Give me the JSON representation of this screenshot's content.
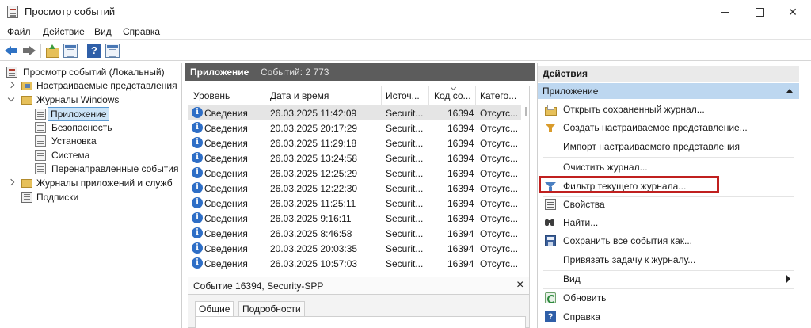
{
  "window": {
    "title": "Просмотр событий"
  },
  "menu": [
    "Файл",
    "Действие",
    "Вид",
    "Справка"
  ],
  "toolbar": {
    "help_glyph": "?"
  },
  "tree": {
    "root": "Просмотр событий (Локальный)",
    "custom_views": "Настраиваемые представления",
    "windows_logs": "Журналы Windows",
    "logs": [
      "Приложение",
      "Безопасность",
      "Установка",
      "Система",
      "Перенаправленные события"
    ],
    "app_logs": "Журналы приложений и служб",
    "subscriptions": "Подписки",
    "selected": "Приложение"
  },
  "center": {
    "title": "Приложение",
    "count": "Событий: 2 773",
    "columns": [
      "Уровень",
      "Дата и время",
      "Источ...",
      "Код со...",
      "Катего..."
    ],
    "rows": [
      {
        "level": "Сведения",
        "datetime": "26.03.2025 11:42:09",
        "source": "Securit...",
        "code": "16394",
        "category": "Отсутс..."
      },
      {
        "level": "Сведения",
        "datetime": "20.03.2025 20:17:29",
        "source": "Securit...",
        "code": "16394",
        "category": "Отсутс..."
      },
      {
        "level": "Сведения",
        "datetime": "26.03.2025 11:29:18",
        "source": "Securit...",
        "code": "16394",
        "category": "Отсутс..."
      },
      {
        "level": "Сведения",
        "datetime": "26.03.2025 13:24:58",
        "source": "Securit...",
        "code": "16394",
        "category": "Отсутс..."
      },
      {
        "level": "Сведения",
        "datetime": "26.03.2025 12:25:29",
        "source": "Securit...",
        "code": "16394",
        "category": "Отсутс..."
      },
      {
        "level": "Сведения",
        "datetime": "26.03.2025 12:22:30",
        "source": "Securit...",
        "code": "16394",
        "category": "Отсутс..."
      },
      {
        "level": "Сведения",
        "datetime": "26.03.2025 11:25:11",
        "source": "Securit...",
        "code": "16394",
        "category": "Отсутс..."
      },
      {
        "level": "Сведения",
        "datetime": "26.03.2025 9:16:11",
        "source": "Securit...",
        "code": "16394",
        "category": "Отсутс..."
      },
      {
        "level": "Сведения",
        "datetime": "26.03.2025 8:46:58",
        "source": "Securit...",
        "code": "16394",
        "category": "Отсутс..."
      },
      {
        "level": "Сведения",
        "datetime": "20.03.2025 20:03:35",
        "source": "Securit...",
        "code": "16394",
        "category": "Отсутс..."
      },
      {
        "level": "Сведения",
        "datetime": "26.03.2025 10:57:03",
        "source": "Securit...",
        "code": "16394",
        "category": "Отсутс..."
      }
    ],
    "detail_title": "Событие 16394, Security-SPP",
    "detail_close": "×",
    "tabs": [
      "Общие",
      "Подробности"
    ]
  },
  "actions": {
    "title": "Действия",
    "section": "Приложение",
    "items": [
      "Открыть сохраненный журнал...",
      "Создать настраиваемое представление...",
      "Импорт настраиваемого представления",
      "Очистить журнал...",
      "Фильтр текущего журнала...",
      "Свойства",
      "Найти...",
      "Сохранить все события как...",
      "Привязать задачу к журналу...",
      "Вид",
      "Обновить",
      "Справка"
    ],
    "help_glyph": "?",
    "highlighted": "Фильтр текущего журнала...",
    "highlight_color": "#c0201f"
  }
}
